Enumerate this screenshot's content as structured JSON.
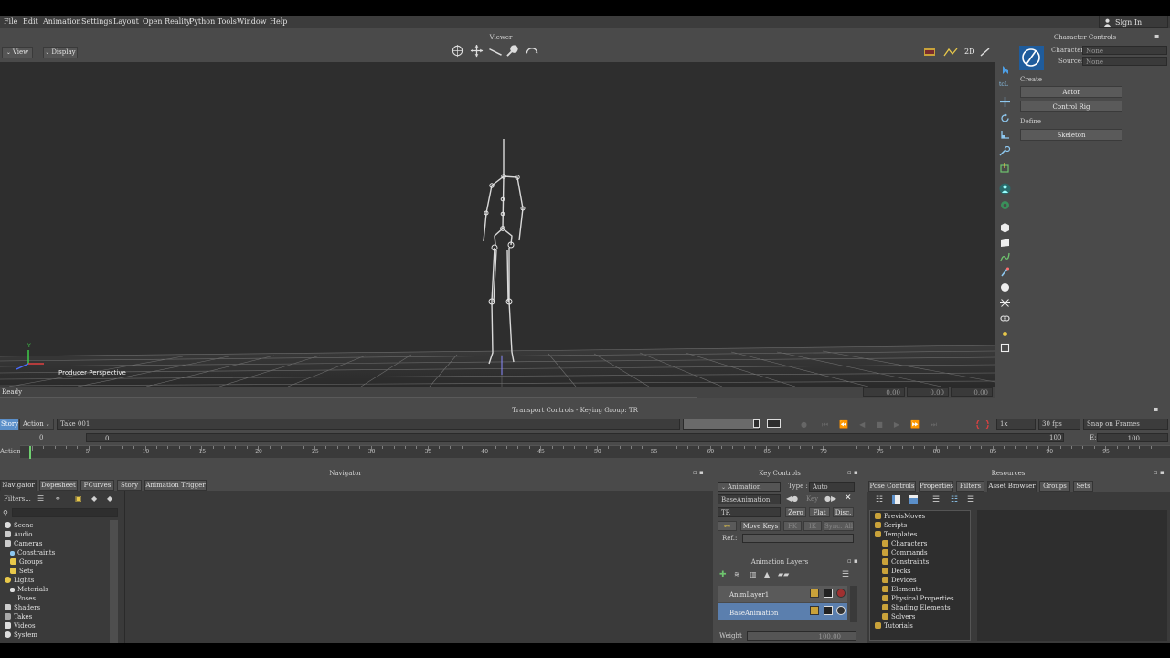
{
  "menu": [
    "File",
    "Edit",
    "Animation",
    "Settings",
    "Layout",
    "Open Reality",
    "Python Tools",
    "Window",
    "Help"
  ],
  "signin_label": "Sign In",
  "viewer": {
    "title": "Viewer",
    "view_btn": "View",
    "display_btn": "Display",
    "camera_label": "Producer Perspective",
    "status": "Ready",
    "status_values": [
      "0.00",
      "0.00",
      "0.00"
    ]
  },
  "character_controls": {
    "title": "Character Controls",
    "character_label": "Character:",
    "character_value": "None",
    "source_label": "Source:",
    "source_value": "None",
    "create_label": "Create",
    "actor_btn": "Actor",
    "control_rig_btn": "Control Rig",
    "define_label": "Define",
    "skeleton_btn": "Skeleton"
  },
  "transport": {
    "title": "Transport Controls  -  Keying Group: TR",
    "story_tab": "Story",
    "action_tab": "Action",
    "take": "Take 001",
    "speed": "1x",
    "fps": "30 fps",
    "snap": "Snap on Frames",
    "start_frame": "0",
    "current_frame": "0",
    "end_value": "100",
    "e_label": "E:",
    "e_value": "100",
    "action_label": "Action",
    "ruler_ticks": [
      "5",
      "10",
      "15",
      "20",
      "25",
      "30",
      "35",
      "40",
      "45",
      "50",
      "55",
      "60",
      "65",
      "70",
      "75",
      "80",
      "85",
      "90",
      "95"
    ]
  },
  "navigator": {
    "title": "Navigator",
    "tabs": [
      "Navigator",
      "Dopesheet",
      "FCurves",
      "Story",
      "Animation Trigger"
    ],
    "filters": "Filters...",
    "tree": [
      "Scene",
      "Audio",
      "Cameras",
      "Constraints",
      "Groups",
      "Sets",
      "Lights",
      "Materials",
      "Poses",
      "Shaders",
      "Takes",
      "Videos",
      "System"
    ]
  },
  "key_controls": {
    "title": "Key Controls",
    "animation_dd": "Animation",
    "type_label": "Type :",
    "type_value": "Auto",
    "layer_dd": "BaseAnimation",
    "key_label": "Key",
    "tr_dd": "TR",
    "zero_btn": "Zero",
    "flat_btn": "Flat",
    "disc_btn": "Disc.",
    "move_keys_btn": "Move Keys",
    "fk_btn": "FK",
    "ik_btn": "IK",
    "sync_btn": "Sync. All",
    "ref_label": "Ref.:"
  },
  "anim_layers": {
    "title": "Animation Layers",
    "layers": [
      "AnimLayer1",
      "BaseAnimation"
    ],
    "weight_label": "Weight",
    "weight_value": "100.00"
  },
  "resources": {
    "title": "Resources",
    "tabs": [
      "Pose Controls",
      "Properties",
      "Filters",
      "Asset Browser",
      "Groups",
      "Sets"
    ],
    "tree": [
      "PrevisMoves",
      "Scripts",
      "Templates",
      "Characters",
      "Commands",
      "Constraints",
      "Decks",
      "Devices",
      "Elements",
      "Physical Properties",
      "Shading Elements",
      "Solvers",
      "Tutorials"
    ]
  },
  "colors": {
    "accent": "#5b8fc9",
    "selected_layer": "#5b7fae",
    "viewport": "#2e2e2e",
    "panel": "#4a4a4a"
  }
}
